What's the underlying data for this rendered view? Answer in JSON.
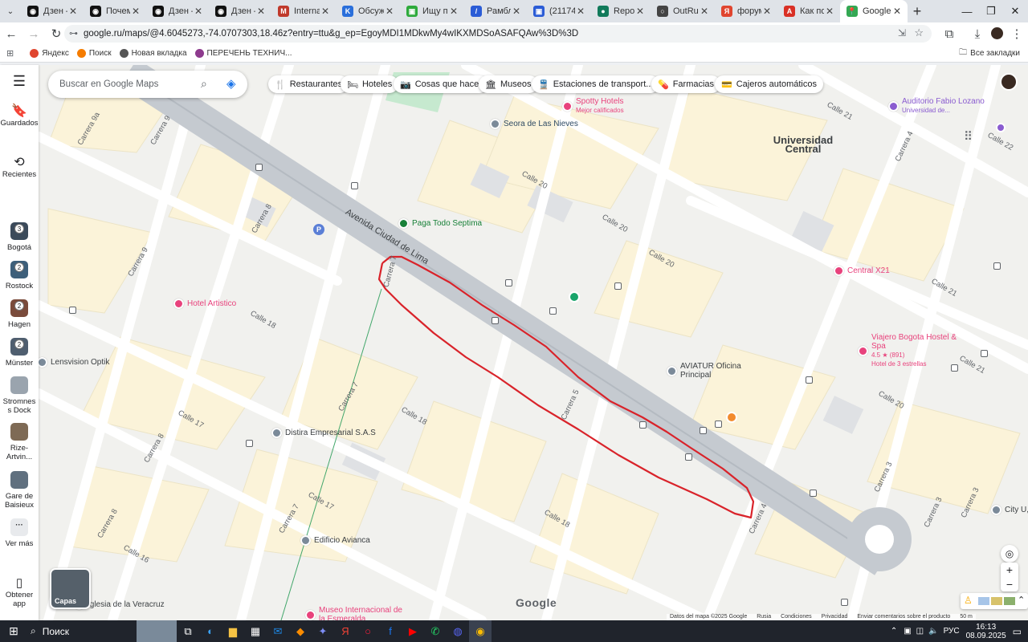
{
  "tabs": [
    {
      "title": "Дзен —",
      "color": "#111111",
      "glyph": "◉"
    },
    {
      "title": "Почему",
      "color": "#111111",
      "glyph": "◉"
    },
    {
      "title": "Дзен —",
      "color": "#111111",
      "glyph": "◉"
    },
    {
      "title": "Дзен —",
      "color": "#111111",
      "glyph": "◉"
    },
    {
      "title": "Internati",
      "color": "#c0392b",
      "glyph": "M"
    },
    {
      "title": "Обсужд",
      "color": "#2a6fdb",
      "glyph": "K"
    },
    {
      "title": "Ищу по",
      "color": "#2eaa3c",
      "glyph": "▣"
    },
    {
      "title": "Рамблер",
      "color": "#2b5cd6",
      "glyph": "/"
    },
    {
      "title": "(21174)",
      "color": "#2b5cd6",
      "glyph": "▣"
    },
    {
      "title": "Report",
      "color": "#117a5a",
      "glyph": "●"
    },
    {
      "title": "OutRush",
      "color": "#444444",
      "glyph": "○"
    },
    {
      "title": "форум",
      "color": "#e0452f",
      "glyph": "Я"
    },
    {
      "title": "Как пос",
      "color": "#d93025",
      "glyph": "A"
    },
    {
      "title": "Google",
      "color": "#34a853",
      "glyph": "📍"
    }
  ],
  "omnibox": {
    "url": "google.ru/maps/@4.6045273,-74.0707303,18.46z?entry=ttu&g_ep=EgoyMDI1MDkwMy4wIKXMDSoASAFQAw%3D%3D"
  },
  "bookmarks": {
    "items": [
      {
        "label": "Яндекс",
        "color": "#e0452f"
      },
      {
        "label": "Поиск",
        "color": "#f57c00"
      },
      {
        "label": "Новая вкладка",
        "color": "#555555"
      },
      {
        "label": "ПЕРЕЧЕНЬ ТЕХНИЧ...",
        "color": "#8e3b8e"
      }
    ],
    "all": "Все закладки"
  },
  "rail": {
    "saved": "Guardados",
    "recents": "Recientes",
    "places": [
      {
        "label": "Bogotá",
        "badge": "3",
        "color": "#3b4a5a"
      },
      {
        "label": "Rostock",
        "badge": "2",
        "color": "#3d5f7a"
      },
      {
        "label": "Hagen",
        "badge": "2",
        "color": "#7a4b3b"
      },
      {
        "label": "Münster",
        "badge": "2",
        "color": "#4f5e6f"
      },
      {
        "label": "Stromnes s Dock",
        "badge": "",
        "color": "#9aa4ae"
      },
      {
        "label": "Rize-Artvin...",
        "badge": "",
        "color": "#7e6a55"
      },
      {
        "label": "Gare de Baisieux",
        "badge": "",
        "color": "#60707f"
      }
    ],
    "more": "Ver más",
    "getapp": "Obtener app"
  },
  "search": {
    "placeholder": "Buscar en Google Maps"
  },
  "chips": [
    {
      "label": "Restaurantes",
      "icon": "🍴"
    },
    {
      "label": "Hoteles",
      "icon": "🛏"
    },
    {
      "label": "Cosas que hacer",
      "icon": "📷"
    },
    {
      "label": "Museos",
      "icon": "🏛"
    },
    {
      "label": "Estaciones de transport...",
      "icon": "🚆"
    },
    {
      "label": "Farmacias",
      "icon": "💊"
    },
    {
      "label": "Cajeros automáticos",
      "icon": "💳"
    }
  ],
  "map": {
    "pois": [
      {
        "name": "Seora de Las Nieves",
        "sub": "",
        "color": "#7b8a99"
      },
      {
        "name": "Spotty Hotels",
        "sub": "Mejor calificados",
        "color": "#e8427c"
      },
      {
        "name": "Universidad Central",
        "sub": "",
        "color": "#5f6368"
      },
      {
        "name": "Auditorio Fabio Lozano",
        "sub": "Universidad de...",
        "color": "#8a5cd0"
      },
      {
        "name": "Paga Todo Septima",
        "sub": "",
        "color": "#188038"
      },
      {
        "name": "Central X21",
        "sub": "",
        "color": "#e8427c"
      },
      {
        "name": "Viajero Bogota Hostel & Spa",
        "sub": "4.5 ★ (891)",
        "sub2": "Hotel de 3 estrellas",
        "color": "#e8427c"
      },
      {
        "name": "Hotel Artistico",
        "sub": "",
        "color": "#e8427c"
      },
      {
        "name": "Lensvision Optik",
        "sub": "",
        "color": "#7b8a99"
      },
      {
        "name": "AVIATUR Oficina Principal",
        "sub": "",
        "color": "#7b8a99"
      },
      {
        "name": "Distira Empresarial S.A.S",
        "sub": "",
        "color": "#7b8a99"
      },
      {
        "name": "Edificio Avianca",
        "sub": "",
        "color": "#7b8a99"
      },
      {
        "name": "Museo Internacional de la Esmeralda",
        "sub": "",
        "color": "#e8427c"
      },
      {
        "name": "Iglesia de la Veracruz",
        "sub": "",
        "color": "#7b8a99"
      },
      {
        "name": "City U, Univer",
        "sub": "",
        "color": "#7b8a99"
      }
    ],
    "streets": [
      "Avenida Ciudad de Lima",
      "Calle 18",
      "Calle 18",
      "Calle 18",
      "Calle 17",
      "Calle 17",
      "Calle 16",
      "Calle 20",
      "Calle 20",
      "Calle 20",
      "Calle 20",
      "Calle 21",
      "Calle 21",
      "Calle 21",
      "Calle 22",
      "Carrera 9",
      "Carrera 9",
      "Carrera 9a",
      "Carrera 8",
      "Carrera 8",
      "Carrera 8",
      "Carrera 7",
      "Carrera 7",
      "Carrera 7",
      "Carrera 5",
      "Carrera 4",
      "Carrera 4",
      "Carrera 3",
      "Carrera 3",
      "Carrera 3"
    ],
    "layers": "Capas",
    "logo": "Google"
  },
  "attribution": {
    "data": "Datos del mapa ©2025 Google",
    "country": "Rusia",
    "terms": "Condiciones",
    "privacy": "Privacidad",
    "feedback": "Enviar comentarios sobre el producto",
    "scale": "50 m"
  },
  "taskbar": {
    "search": "Поиск",
    "lang": "РУС",
    "time": "16:13",
    "date": "08.09.2025"
  }
}
